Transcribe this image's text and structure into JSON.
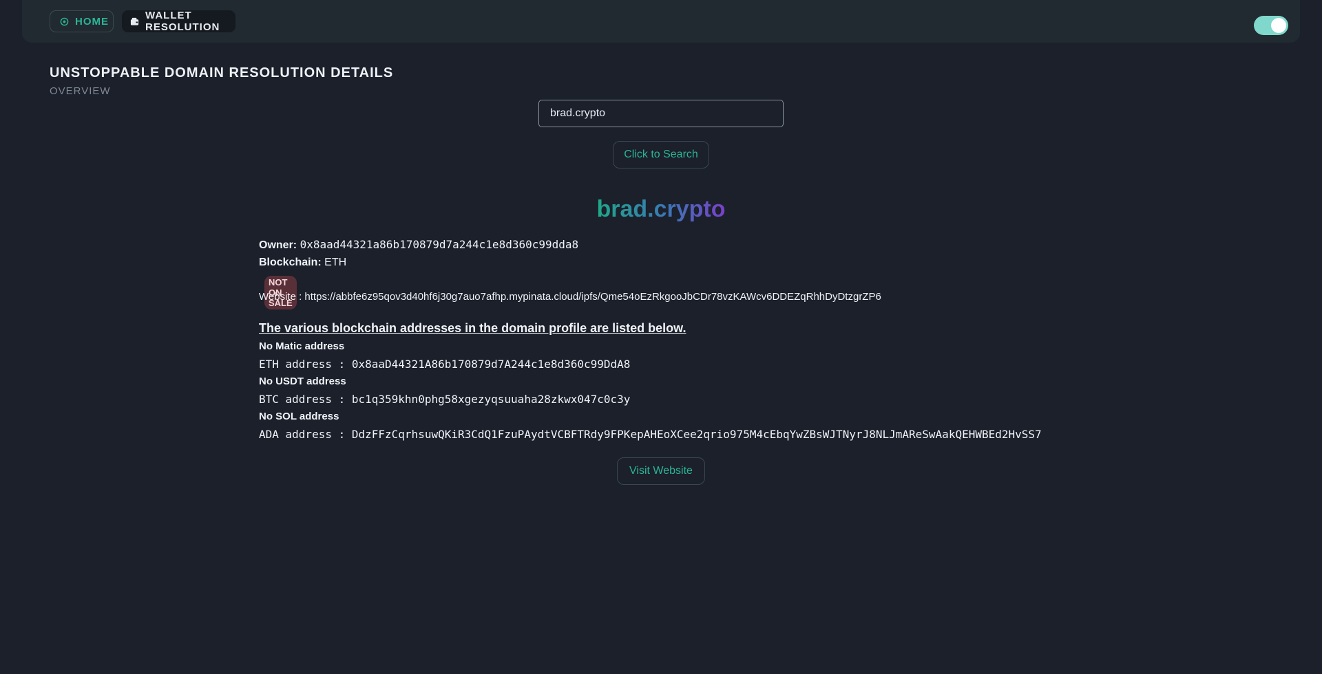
{
  "nav": {
    "home_label": "HOME",
    "wallet_label": "WALLET RESOLUTION",
    "home_icon": "home-icon",
    "wallet_icon": "wallet-icon",
    "theme_toggle_on": true
  },
  "page": {
    "title": "UNSTOPPABLE DOMAIN RESOLUTION DETAILS",
    "subtitle": "OVERVIEW"
  },
  "search": {
    "value": "brad.crypto",
    "button_label": "Click to Search"
  },
  "result": {
    "domain": "brad.crypto",
    "owner_label": "Owner:",
    "owner": "0x8aad44321a86b170879d7a244c1e8d360c99dda8",
    "blockchain_label": "Blockchain:",
    "blockchain": "ETH",
    "sale_badge": "NOT ON SALE",
    "website_label": "Website :",
    "website": "https://abbfe6z95qov3d40hf6j30g7auo7afhp.mypinata.cloud/ipfs/Qme54oEzRkgooJbCDr78vzKAWcv6DDEZqRhhDyDtzgrZP6",
    "addresses_heading": "The various blockchain addresses in the domain profile are listed below.",
    "no_matic": "No Matic address",
    "eth_address": "ETH address : 0x8aaD44321A86b170879d7A244c1e8d360c99DdA8",
    "no_usdt": "No USDT address",
    "btc_address": "BTC address : bc1q359khn0phg58xgezyqsuuaha28zkwx047c0c3y",
    "no_sol": "No SOL address",
    "ada_address": "ADA address : DdzFFzCqrhsuwQKiR3CdQ1FzuPAydtVCBFTRdy9FPKepAHEoXCee2qrio975M4cEbqYwZBsWJTNyrJ8NLJmAReSwAakQEHWBEd2HvSS7",
    "visit_label": "Visit Website"
  },
  "colors": {
    "background": "#1b202b",
    "accent": "#2bb596",
    "toggle": "#7fd8cb",
    "badge": "#5a3038"
  }
}
